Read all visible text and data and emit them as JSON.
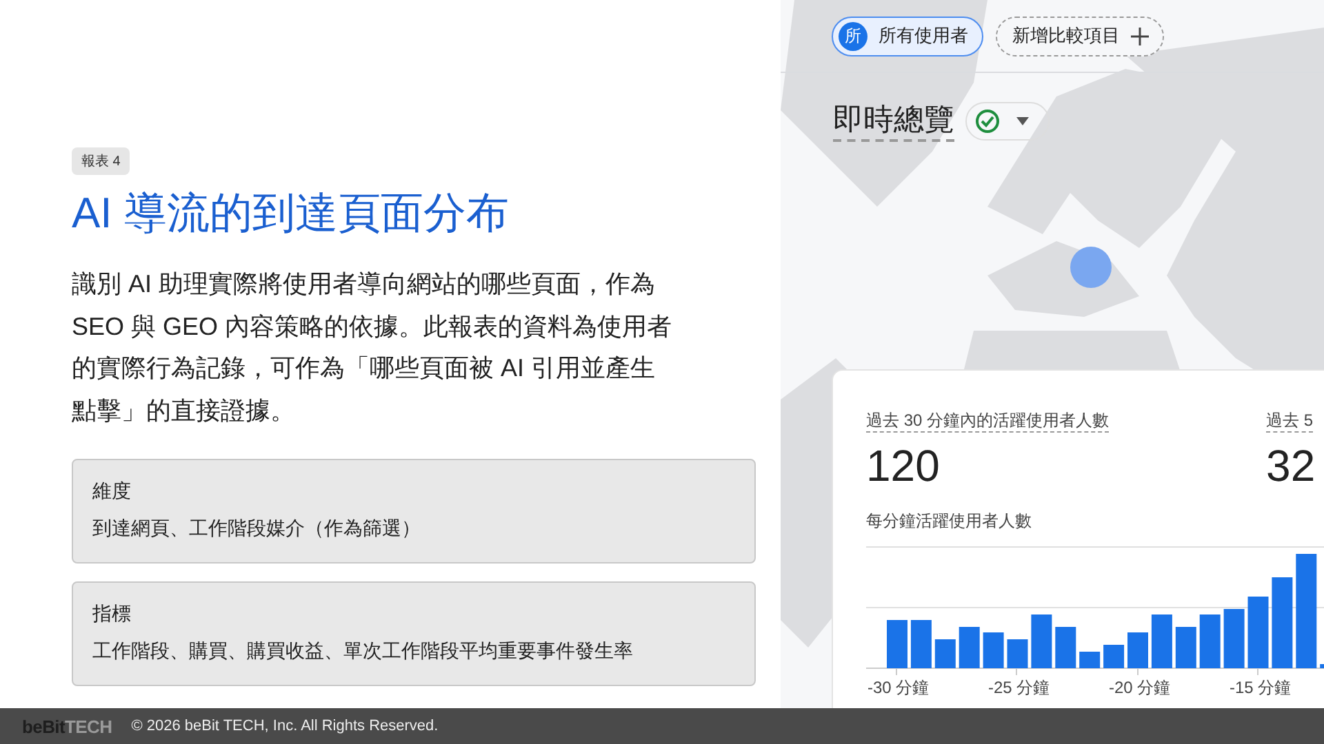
{
  "report_label": "報表 4",
  "title": "AI 導流的到達頁面分布",
  "description": "識別 AI 助理實際將使用者導向網站的哪些頁面，作為 SEO 與 GEO 內容策略的依據。此報表的資料為使用者的實際行為記錄，可作為「哪些頁面被 AI 引用並產生點擊」的直接證據。",
  "info_boxes": [
    {
      "label": "維度",
      "value": "到達網頁、工作階段媒介（作為篩選）"
    },
    {
      "label": "指標",
      "value": "工作階段、購買、購買收益、單次工作階段平均重要事件發生率"
    }
  ],
  "screenshot": {
    "segment_chips": [
      {
        "kind": "segment",
        "badge": "所",
        "label": "所有使用者"
      },
      {
        "kind": "add",
        "label": "新增比較項目"
      }
    ],
    "page_title": "即時總覽",
    "card": {
      "metrics": [
        {
          "label": "過去 30 分鐘內的活躍使用者人數",
          "value": "120"
        },
        {
          "label": "過去 5",
          "value": "32"
        }
      ],
      "chart_title": "每分鐘活躍使用者人數",
      "x_labels": [
        "-30 分鐘",
        "-25 分鐘",
        "-20 分鐘",
        "-15 分鐘"
      ]
    }
  },
  "footer": {
    "logo_main": "beBit",
    "logo_accent": "TECH",
    "copyright": "© 2026 beBit TECH, Inc. All Rights Reserved."
  }
}
